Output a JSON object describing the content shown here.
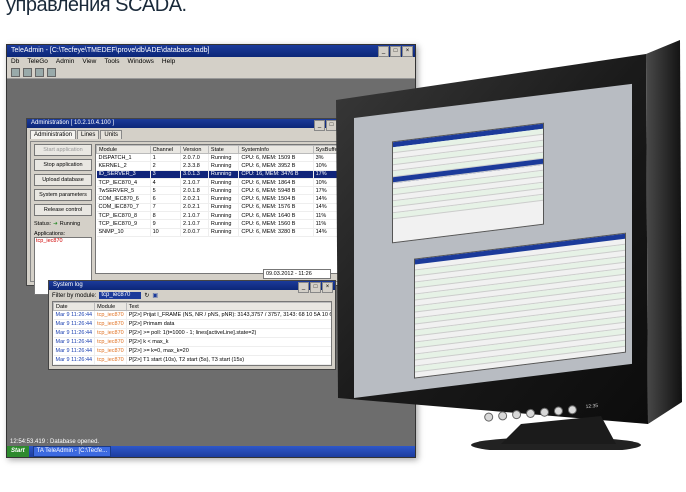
{
  "caption": "управления SCADA.",
  "desktop": {
    "title": "TeleAdmin - [C:\\Tecfeye\\TMEDEF\\prove\\db\\ADE\\database.tadb]",
    "menu": [
      "Db",
      "TeleGo",
      "Admin",
      "View",
      "Tools",
      "Windows",
      "Help"
    ],
    "status_text": "12:54:53.419 : Database opened.",
    "taskbar": {
      "start": "Start",
      "item": "TA TeleAdmin - [C:\\Tecfe..."
    }
  },
  "admin": {
    "title": "Administration [ 10.2.10.4.100 ]",
    "tabs": [
      "Administration",
      "Lines",
      "Units"
    ],
    "buttons": [
      "Start application",
      "Stop application",
      "Upload database",
      "System parameters",
      "Release control"
    ],
    "status_label": "Status:",
    "status_value": "Running",
    "applications_label": "Applications:",
    "applications": [
      "tcp_iec870"
    ],
    "columns": [
      "Module",
      "Channel",
      "Version",
      "State",
      "SystemInfo",
      "SysBuffer"
    ],
    "rows": [
      [
        "DISPATCH_1",
        "1",
        "2.0.7.0",
        "Running",
        "CPU: 6, MEM: 1509 B",
        "3%"
      ],
      [
        "KERNEL_2",
        "2",
        "2.3.3.8",
        "Running",
        "CPU: 6, MEM: 3952 B",
        "10%"
      ],
      [
        "ID_SERVER_3",
        "3",
        "3.0.1.3",
        "Running",
        "CPU: 16, MEM: 3476 B",
        "17%"
      ],
      [
        "TCP_IEC870_4",
        "4",
        "2.1.0.7",
        "Running",
        "CPU: 6, MEM: 1864 B",
        "10%"
      ],
      [
        "TwSERVER_5",
        "5",
        "2.0.1.8",
        "Running",
        "CPU: 6, MEM: 5948 B",
        "17%"
      ],
      [
        "COM_IEC870_6",
        "6",
        "2.0.2.1",
        "Running",
        "CPU: 6, MEM: 1504 B",
        "14%"
      ],
      [
        "COM_IEC870_7",
        "7",
        "2.0.2.1",
        "Running",
        "CPU: 6, MEM: 1576 B",
        "14%"
      ],
      [
        "TCP_IEC870_8",
        "8",
        "2.1.0.7",
        "Running",
        "CPU: 6, MEM: 1640 B",
        "11%"
      ],
      [
        "TCP_IEC870_9",
        "9",
        "2.1.0.7",
        "Running",
        "CPU: 6, MEM: 1560 B",
        "11%"
      ],
      [
        "SNMP_10",
        "10",
        "2.0.0.7",
        "Running",
        "CPU: 6, MEM: 3280 B",
        "14%"
      ]
    ],
    "selected_row": 2,
    "date": "09.03.2012 - 11:26"
  },
  "syslog": {
    "title": "System log",
    "filter_label": "Filter by module:",
    "filter_value": "tcp_iec870",
    "columns": [
      "Date",
      "Module",
      "Text"
    ],
    "rows": [
      [
        "Mar 9 11:26:44",
        "tcp_iec870",
        "P[2>] Prijat I_FRAME (NS, NR / pNS, pNR): 3143,3757 / 3757, 3143: 68 10 5A 10 6E 1B..."
      ],
      [
        "Mar 9 11:26:44",
        "tcp_iec870",
        "P[2>] Primam data"
      ],
      [
        "Mar 9 11:26:44",
        "tcp_iec870",
        "P[2>] >= poll: 1(t=1000 - 1; lines[activeLine].state=2)"
      ],
      [
        "Mar 9 11:26:44",
        "tcp_iec870",
        "P[2>] k < max_k"
      ],
      [
        "Mar 9 11:26:44",
        "tcp_iec870",
        "P[2>] >= k=0, max_k=20"
      ],
      [
        "Mar 9 11:26:44",
        "tcp_iec870",
        "P[2>] T1 start (10s), T2 start (5s), T3 start (15s)"
      ]
    ]
  },
  "monitor": {
    "clock": "12:35"
  },
  "colors": {
    "titlebar": "#0c2778",
    "selection": "#10247a",
    "taskbar": "#1c3c9e",
    "app_text": "#d00000"
  }
}
